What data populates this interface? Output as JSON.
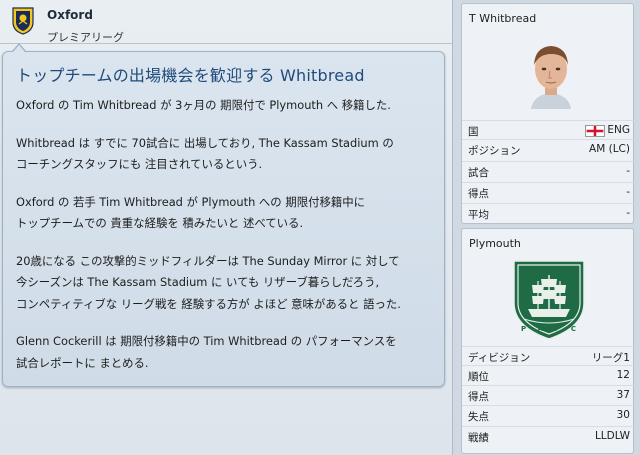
{
  "club": {
    "name": "Oxford",
    "league": "プレミアリーグ"
  },
  "article": {
    "title": "トップチームの出場機会を歓迎する Whitbread",
    "paragraphs": [
      [
        "Oxford の Tim Whitbread が 3ヶ月の 期限付で Plymouth へ 移籍した."
      ],
      [
        "Whitbread は すでに 70試合に 出場しており, The Kassam Stadium の",
        "コーチングスタッフにも 注目されているという."
      ],
      [
        "Oxford の 若手 Tim Whitbread が Plymouth への 期限付移籍中に",
        "トップチームでの 貴重な経験を 積みたいと 述べている."
      ],
      [
        "20歳になる この攻撃的ミッドフィルダーは The Sunday Mirror に 対して",
        "今シーズンは The Kassam Stadium に いても リザーブ暮らしだろう,",
        "コンペティティブな リーグ戦を 経験する方が よほど 意味があると 語った."
      ],
      [
        "Glenn Cockerill は 期限付移籍中の Tim Whitbread の パフォーマンスを",
        "試合レポートに まとめる."
      ]
    ]
  },
  "player_card": {
    "name": "T Whitbread",
    "rows": [
      {
        "label": "国",
        "value": "ENG"
      },
      {
        "label": "ポジション",
        "value": "AM (LC)"
      },
      {
        "label": "試合",
        "value": "-"
      },
      {
        "label": "得点",
        "value": "-"
      },
      {
        "label": "平均",
        "value": "-"
      }
    ]
  },
  "club_card": {
    "name": "Plymouth",
    "crest_text": "P · A · F · C",
    "rows": [
      {
        "label": "ディビジョン",
        "value": "リーグ1"
      },
      {
        "label": "順位",
        "value": "12"
      },
      {
        "label": "得点",
        "value": "37"
      },
      {
        "label": "失点",
        "value": "30"
      },
      {
        "label": "戦績",
        "value": "LLDLW"
      }
    ]
  },
  "colors": {
    "title": "#1f4a7a",
    "crest_green": "#1e6b45",
    "flag_red": "#cf142b"
  }
}
